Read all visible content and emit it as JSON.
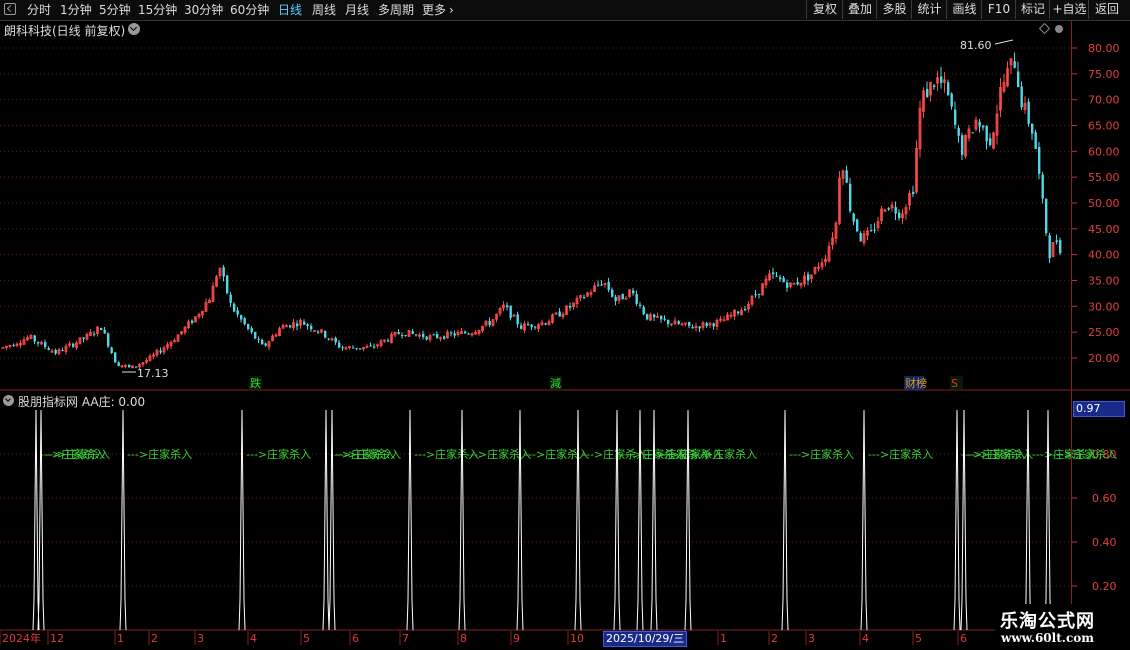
{
  "toolbar": {
    "periods": [
      "分时",
      "1分钟",
      "5分钟",
      "15分钟",
      "30分钟",
      "60分钟",
      "日线",
      "周线",
      "月线",
      "多周期",
      "更多"
    ],
    "active_period": "日线",
    "right_buttons": [
      "复权",
      "叠加",
      "多股",
      "统计",
      "画线",
      "F10",
      "标记",
      "+自选",
      "返回"
    ]
  },
  "main_chart": {
    "title": "朗科科技(日线 前复权)",
    "price_axis": [
      "80.00",
      "75.00",
      "70.00",
      "65.00",
      "60.00",
      "55.00",
      "50.00",
      "45.00",
      "40.00",
      "35.00",
      "30.00",
      "25.00",
      "20.00"
    ],
    "high_label": "81.60",
    "low_label": "17.13",
    "event_markers": [
      "跌",
      "減",
      "财榜",
      "S"
    ]
  },
  "sub_chart": {
    "title": "股朋指标网 AA庄: 0.00",
    "axis_labels": [
      "0.80",
      "0.60",
      "0.40",
      "0.20"
    ],
    "current_value": "0.97",
    "signal_text": "--->庄家杀入",
    "signal_text_short": "--->庄家杀入"
  },
  "date_axis": {
    "labels": [
      "2024年",
      "12",
      "1",
      "2",
      "3",
      "4",
      "5",
      "6",
      "7",
      "8",
      "9",
      "10",
      "11",
      "1",
      "2",
      "3",
      "4",
      "5",
      "6"
    ],
    "highlight": "2025/10/29/三"
  },
  "watermark": {
    "line1": "乐淘公式网",
    "line2": "www.60lt.com"
  },
  "colors": {
    "up": "#ff4a4a",
    "down": "#4fd8e8",
    "signal": "#3ad33a",
    "grid": "#7a1010"
  }
}
